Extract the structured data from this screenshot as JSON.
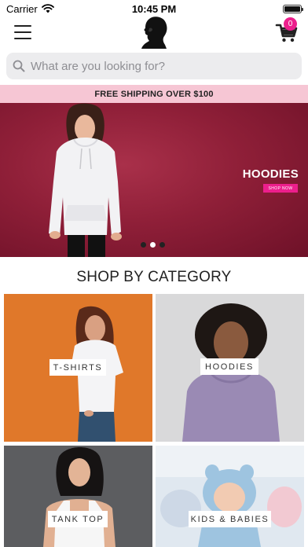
{
  "status_bar": {
    "carrier": "Carrier",
    "time": "10:45 PM"
  },
  "header": {
    "cart_count": "0"
  },
  "search": {
    "placeholder": "What are you looking for?"
  },
  "promo_bar": {
    "text": "FREE SHIPPING OVER $100"
  },
  "hero": {
    "title": "HOODIES",
    "cta_label": "SHOP NOW",
    "slide_count": 3,
    "active_slide": 2
  },
  "categories": {
    "heading": "SHOP BY CATEGORY",
    "items": [
      {
        "label": "T-SHIRTS"
      },
      {
        "label": "HOODIES"
      },
      {
        "label": "TANK TOP"
      },
      {
        "label": "KIDS & BABIES"
      }
    ]
  },
  "colors": {
    "accent_pink": "#ec1f8c",
    "promo_bg": "#f6c6d4",
    "hero_bg": "#8f1f38"
  }
}
